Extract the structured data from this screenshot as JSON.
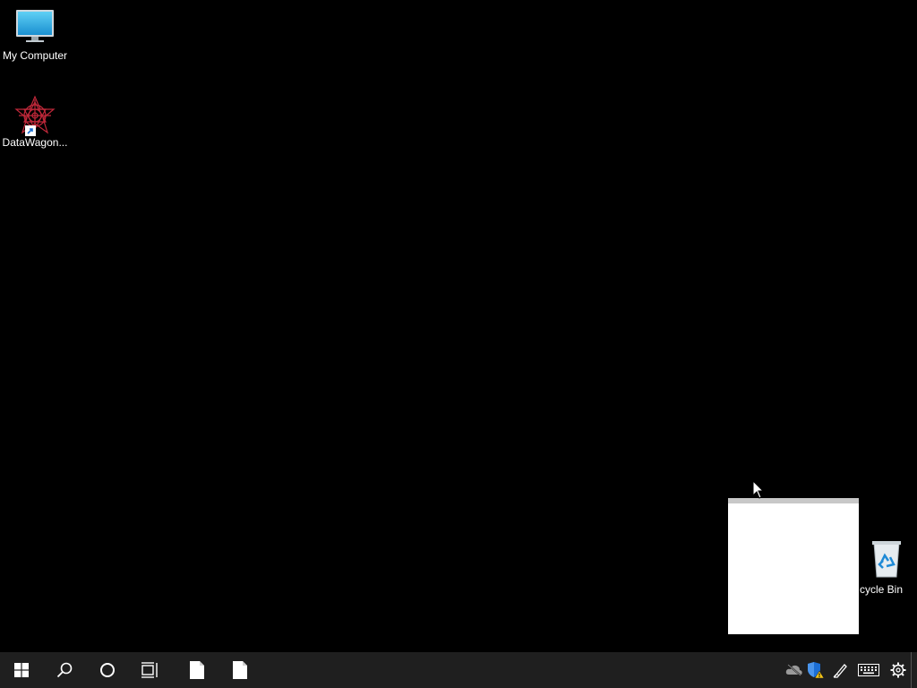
{
  "desktop": {
    "background": "#000000",
    "icons": [
      {
        "label": "My Computer",
        "icon": "monitor-icon"
      },
      {
        "label": "DataWagon...",
        "icon": "datawagon-app-icon"
      },
      {
        "label": "cycle Bin",
        "icon": "recycle-bin-icon"
      }
    ]
  },
  "popup": {
    "color": "#ffffff",
    "bar_color": "#c8c8c8"
  },
  "taskbar": {
    "background": "#1f1f1f",
    "buttons": [
      {
        "icon": "windows-start-icon"
      },
      {
        "icon": "search-icon"
      },
      {
        "icon": "cortana-circle-icon"
      },
      {
        "icon": "task-view-icon"
      },
      {
        "icon": "document-icon"
      },
      {
        "icon": "document-icon"
      }
    ],
    "tray": [
      {
        "icon": "cloud-offline-icon"
      },
      {
        "icon": "security-shield-warning-icon"
      },
      {
        "icon": "pen-icon"
      },
      {
        "icon": "keyboard-icon"
      },
      {
        "icon": "settings-gear-icon"
      }
    ]
  }
}
